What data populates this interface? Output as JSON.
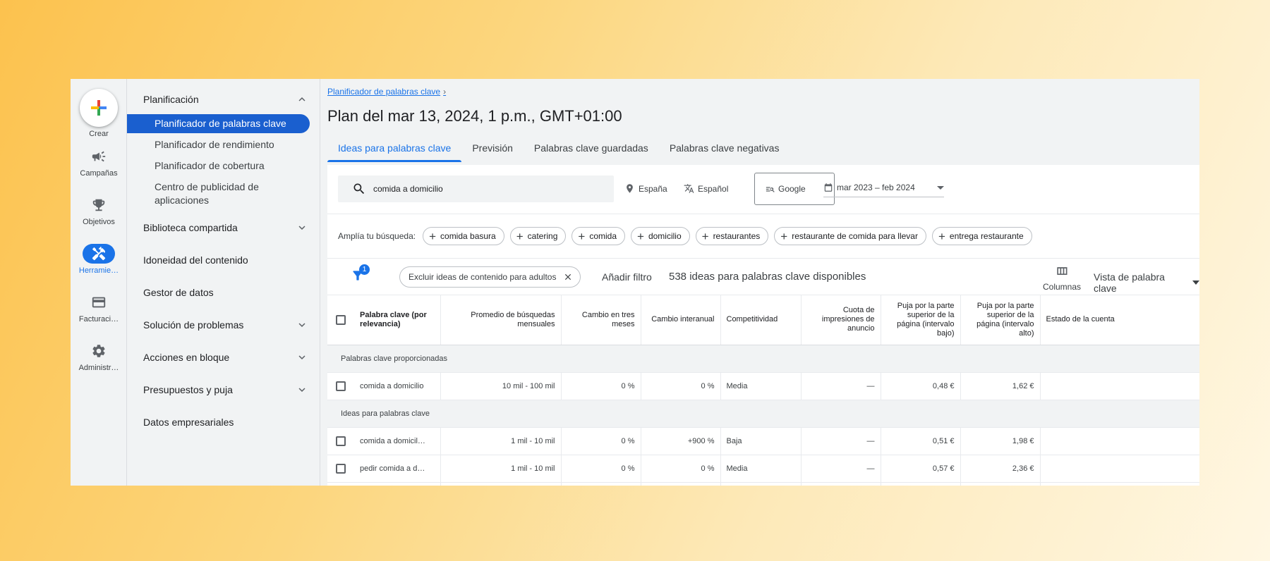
{
  "rail": {
    "create": "Crear",
    "items": [
      {
        "label": "Campañas",
        "icon": "megaphone-icon"
      },
      {
        "label": "Objetivos",
        "icon": "trophy-icon"
      },
      {
        "label": "Herramie…",
        "icon": "tools-icon"
      },
      {
        "label": "Facturaci…",
        "icon": "credit-card-icon"
      },
      {
        "label": "Administr…",
        "icon": "gear-icon"
      }
    ]
  },
  "nav": {
    "planning": "Planificación",
    "planning_items": [
      "Planificador de palabras clave",
      "Planificador de rendimiento",
      "Planificador de cobertura",
      "Centro de publicidad de aplicaciones"
    ],
    "shared_library": "Biblioteca compartida",
    "content_suitability": "Idoneidad del contenido",
    "data_manager": "Gestor de datos",
    "troubleshooting": "Solución de problemas",
    "bulk_actions": "Acciones en bloque",
    "budgets": "Presupuestos y puja",
    "business_data": "Datos empresariales"
  },
  "breadcrumb": "Planificador de palabras clave",
  "plan_title": "Plan del mar 13, 2024, 1 p.m., GMT+01:00",
  "tabs": [
    "Ideas para palabras clave",
    "Previsión",
    "Palabras clave guardadas",
    "Palabras clave negativas"
  ],
  "search": {
    "value": "comida a domicilio",
    "location": "España",
    "language": "Español",
    "network": "Google",
    "date_range": "mar 2023 – feb 2024"
  },
  "broaden": {
    "label": "Amplía tu búsqueda:",
    "chips": [
      "comida basura",
      "catering",
      "comida",
      "domicilio",
      "restaurantes",
      "restaurante de comida para llevar",
      "entrega restaurante"
    ]
  },
  "filters": {
    "badge": "1",
    "adult_chip": "Excluir ideas de contenido para adultos",
    "add_filter": "Añadir filtro",
    "available": "538 ideas para palabras clave disponibles",
    "columns": "Columnas",
    "view": "Vista de palabra clave"
  },
  "table": {
    "headers": [
      "Palabra clave (por relevancia)",
      "Promedio de búsquedas mensuales",
      "Cambio en tres meses",
      "Cambio interanual",
      "Competitividad",
      "Cuota de impresiones de anuncio",
      "Puja por la parte superior de la página (intervalo bajo)",
      "Puja por la parte superior de la página (intervalo alto)",
      "Estado de la cuenta"
    ],
    "section_provided": "Palabras clave proporcionadas",
    "section_ideas": "Ideas para palabras clave",
    "provided_rows": [
      [
        "comida a domicilio",
        "10 mil - 100 mil",
        "0 %",
        "0 %",
        "Media",
        "—",
        "0,48 €",
        "1,62 €",
        ""
      ]
    ],
    "idea_rows": [
      [
        "comida a domicil…",
        "1 mil - 10 mil",
        "0 %",
        "+900 %",
        "Baja",
        "—",
        "0,51 €",
        "1,98 €",
        ""
      ],
      [
        "pedir comida a d…",
        "1 mil - 10 mil",
        "0 %",
        "0 %",
        "Media",
        "—",
        "0,57 €",
        "2,36 €",
        ""
      ]
    ]
  }
}
